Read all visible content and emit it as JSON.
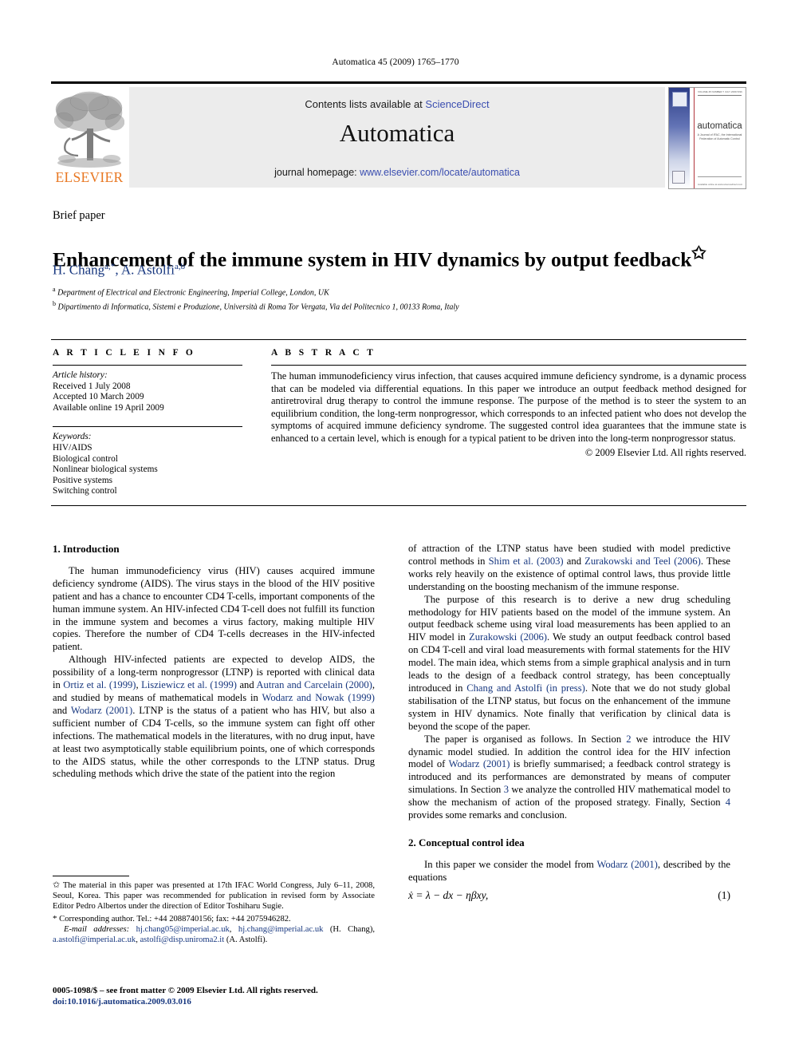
{
  "running_head": "Automatica 45 (2009) 1765–1770",
  "masthead": {
    "publisher_name": "ELSEVIER",
    "contents_prefix": "Contents lists available at ",
    "contents_link": "ScienceDirect",
    "journal_name": "Automatica",
    "homepage_prefix": "journal homepage: ",
    "homepage_link": "www.elsevier.com/locate/automatica",
    "cover": {
      "title": "automatica",
      "subtitle": "A Journal of IFAC, the International Federation of Automatic Control",
      "top_strip": "VOLUME 45 NUMBER 7 JULY 2009     ISSN 0005-1098",
      "bottom_strip": "Available online at www.sciencedirect.com"
    }
  },
  "article": {
    "type_label": "Brief paper",
    "title": "Enhancement of the immune system in HIV dynamics by output feedback",
    "title_star": "✩",
    "authors": "H. Chang",
    "authors_sup1": "a,*",
    "authors_2": ", A. Astolfi",
    "authors_sup2": "a,b",
    "affiliations": [
      {
        "marker": "a",
        "text": "Department of Electrical and Electronic Engineering, Imperial College, London, UK"
      },
      {
        "marker": "b",
        "text": "Dipartimento di Informatica, Sistemi e Produzione, Università di Roma Tor Vergata, Via del Politecnico 1, 00133 Roma, Italy"
      }
    ]
  },
  "info": {
    "heading": "A R T I C L E   I N F O",
    "history_label": "Article history:",
    "history": [
      "Received 1 July 2008",
      "Accepted 10 March 2009",
      "Available online 19 April 2009"
    ],
    "keywords_label": "Keywords:",
    "keywords": [
      "HIV/AIDS",
      "Biological control",
      "Nonlinear biological systems",
      "Positive systems",
      "Switching control"
    ]
  },
  "abstract": {
    "heading": "A B S T R A C T",
    "text": "The human immunodeficiency virus infection, that causes acquired immune deficiency syndrome, is a dynamic process that can be modeled via differential equations. In this paper we introduce an output feedback method designed for antiretroviral drug therapy to control the immune response. The purpose of the method is to steer the system to an equilibrium condition, the long-term nonprogressor, which corresponds to an infected patient who does not develop the symptoms of acquired immune deficiency syndrome. The suggested control idea guarantees that the immune state is enhanced to a certain level, which is enough for a typical patient to be driven into the long-term nonprogressor status.",
    "copyright": "© 2009 Elsevier Ltd. All rights reserved."
  },
  "body": {
    "section1_heading": "1. Introduction",
    "p1": "The human immunodeficiency virus (HIV) causes acquired immune deficiency syndrome (AIDS). The virus stays in the blood of the HIV positive patient and has a chance to encounter CD4 T-cells, important components of the human immune system. An HIV-infected CD4 T-cell does not fulfill its function in the immune system and becomes a virus factory, making multiple HIV copies. Therefore the number of CD4 T-cells decreases in the HIV-infected patient.",
    "p2_a": "Although HIV-infected patients are expected to develop AIDS, the possibility of a long-term nonprogressor (LTNP) is reported with clinical data in ",
    "p2_ref1": "Ortiz et al. (1999)",
    "p2_b": ", ",
    "p2_ref2": "Lisziewicz et al. (1999)",
    "p2_c": " and ",
    "p2_ref3": "Autran and Carcelain (2000)",
    "p2_d": ", and studied by means of mathematical models in ",
    "p2_ref4": "Wodarz and Nowak (1999)",
    "p2_e": " and ",
    "p2_ref5": "Wodarz (2001)",
    "p2_f": ". LTNP is the status of a patient who has HIV, but also a sufficient number of CD4 T-cells, so the immune system can fight off other infections. The mathematical models in the literatures, with no drug input, have at least two asymptotically stable equilibrium points, one of which corresponds to the AIDS status, while the other corresponds to the LTNP status. Drug scheduling methods which drive the state of the patient into the region",
    "p3_a": "of attraction of the LTNP status have been studied with model predictive control methods in ",
    "p3_ref1": "Shim et al. (2003)",
    "p3_b": " and ",
    "p3_ref2": "Zurakowski and Teel (2006)",
    "p3_c": ". These works rely heavily on the existence of optimal control laws, thus provide little understanding on the boosting mechanism of the immune response.",
    "p4_a": "The purpose of this research is to derive a new drug scheduling methodology for HIV patients based on the model of the immune system. An output feedback scheme using viral load measurements has been applied to an HIV model in ",
    "p4_ref1": "Zurakowski (2006)",
    "p4_b": ". We study an output feedback control based on CD4 T-cell and viral load measurements with formal statements for the HIV model. The main idea, which stems from a simple graphical analysis and in turn leads to the design of a feedback control strategy, has been conceptually introduced in ",
    "p4_ref2": "Chang and Astolfi (in press)",
    "p4_c": ". Note that we do not study global stabilisation of the LTNP status, but focus on the enhancement of the immune system in HIV dynamics. Note finally that verification by clinical data is beyond the scope of the paper.",
    "p5_a": "The paper is organised as follows. In Section ",
    "p5_ref1": "2",
    "p5_b": " we introduce the HIV dynamic model studied. In addition the control idea for the HIV infection model of ",
    "p5_ref2": "Wodarz (2001)",
    "p5_c": " is briefly summarised; a feedback  control strategy is introduced and its performances are demonstrated by means of computer simulations. In Section ",
    "p5_ref3": "3",
    "p5_d": " we analyze the controlled HIV mathematical model to show the mechanism of action of the proposed strategy. Finally, Section ",
    "p5_ref4": "4",
    "p5_e": " provides some remarks and conclusion.",
    "section2_heading": "2. Conceptual control idea",
    "p6_a": "In this paper we consider the model from ",
    "p6_ref1": "Wodarz (2001)",
    "p6_b": ", described by the equations",
    "equation1": "ẋ = λ − dx − ηβxy,",
    "equation1_number": "(1)"
  },
  "footnotes": {
    "star_mark": "✩",
    "star_text": "The material in this paper was presented at 17th IFAC World Congress, July 6–11, 2008, Seoul, Korea. This paper was recommended for publication in revised form by Associate Editor Pedro Albertos under the direction of Editor Toshiharu Sugie.",
    "corr_mark": "*",
    "corr_text": "Corresponding author. Tel.: +44 2088740156; fax: +44 2075946282.",
    "email_label": "E-mail addresses:",
    "email1": "hj.chang05@imperial.ac.uk",
    "email_sep1": ", ",
    "email2": "hj.chang@imperial.ac.uk",
    "email_name1": " (H. Chang), ",
    "email3": "a.astolfi@imperial.ac.uk",
    "email_sep2": ", ",
    "email4": "astolfi@disp.uniroma2.it",
    "email_name2": " (A. Astolfi)."
  },
  "bottom": {
    "front_matter": "0005-1098/$ – see front matter © 2009 Elsevier Ltd. All rights reserved.",
    "doi": "doi:10.1016/j.automatica.2009.03.016"
  },
  "colors": {
    "link_blue": "#3b4eb0",
    "ref_blue": "#17377f",
    "elsevier_orange": "#E87722",
    "band_grey": "#ececec"
  }
}
